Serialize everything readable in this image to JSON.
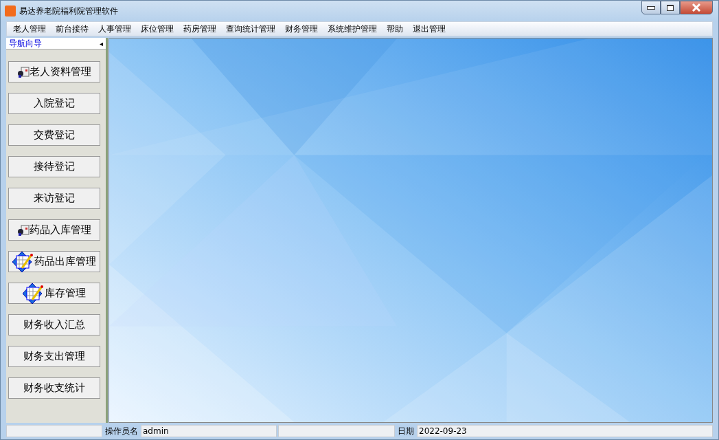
{
  "window": {
    "title": "易达养老院福利院管理软件"
  },
  "menu": [
    {
      "label": "老人管理"
    },
    {
      "label": "前台接待"
    },
    {
      "label": "人事管理"
    },
    {
      "label": "床位管理"
    },
    {
      "label": "药房管理"
    },
    {
      "label": "查询统计管理"
    },
    {
      "label": "财务管理"
    },
    {
      "label": "系统维护管理"
    },
    {
      "label": "帮助"
    },
    {
      "label": "退出管理"
    }
  ],
  "nav": {
    "title": "导航向导",
    "collapse_glyph": "◂",
    "buttons": [
      {
        "label": "老人资料管理",
        "kind": "card"
      },
      {
        "label": "入院登记"
      },
      {
        "label": "交费登记"
      },
      {
        "label": "接待登记"
      },
      {
        "label": "来访登记"
      },
      {
        "label": "药品入库管理",
        "kind": "card"
      },
      {
        "label": "药品出库管理",
        "kind": "edit"
      },
      {
        "label": "库存管理",
        "kind": "edit"
      },
      {
        "label": "财务收入汇总"
      },
      {
        "label": "财务支出管理"
      },
      {
        "label": "财务收支统计"
      }
    ]
  },
  "status_bar": {
    "operator_label": "操作员名",
    "operator": "admin",
    "date_label": "日期",
    "date": "2022-09-23"
  }
}
